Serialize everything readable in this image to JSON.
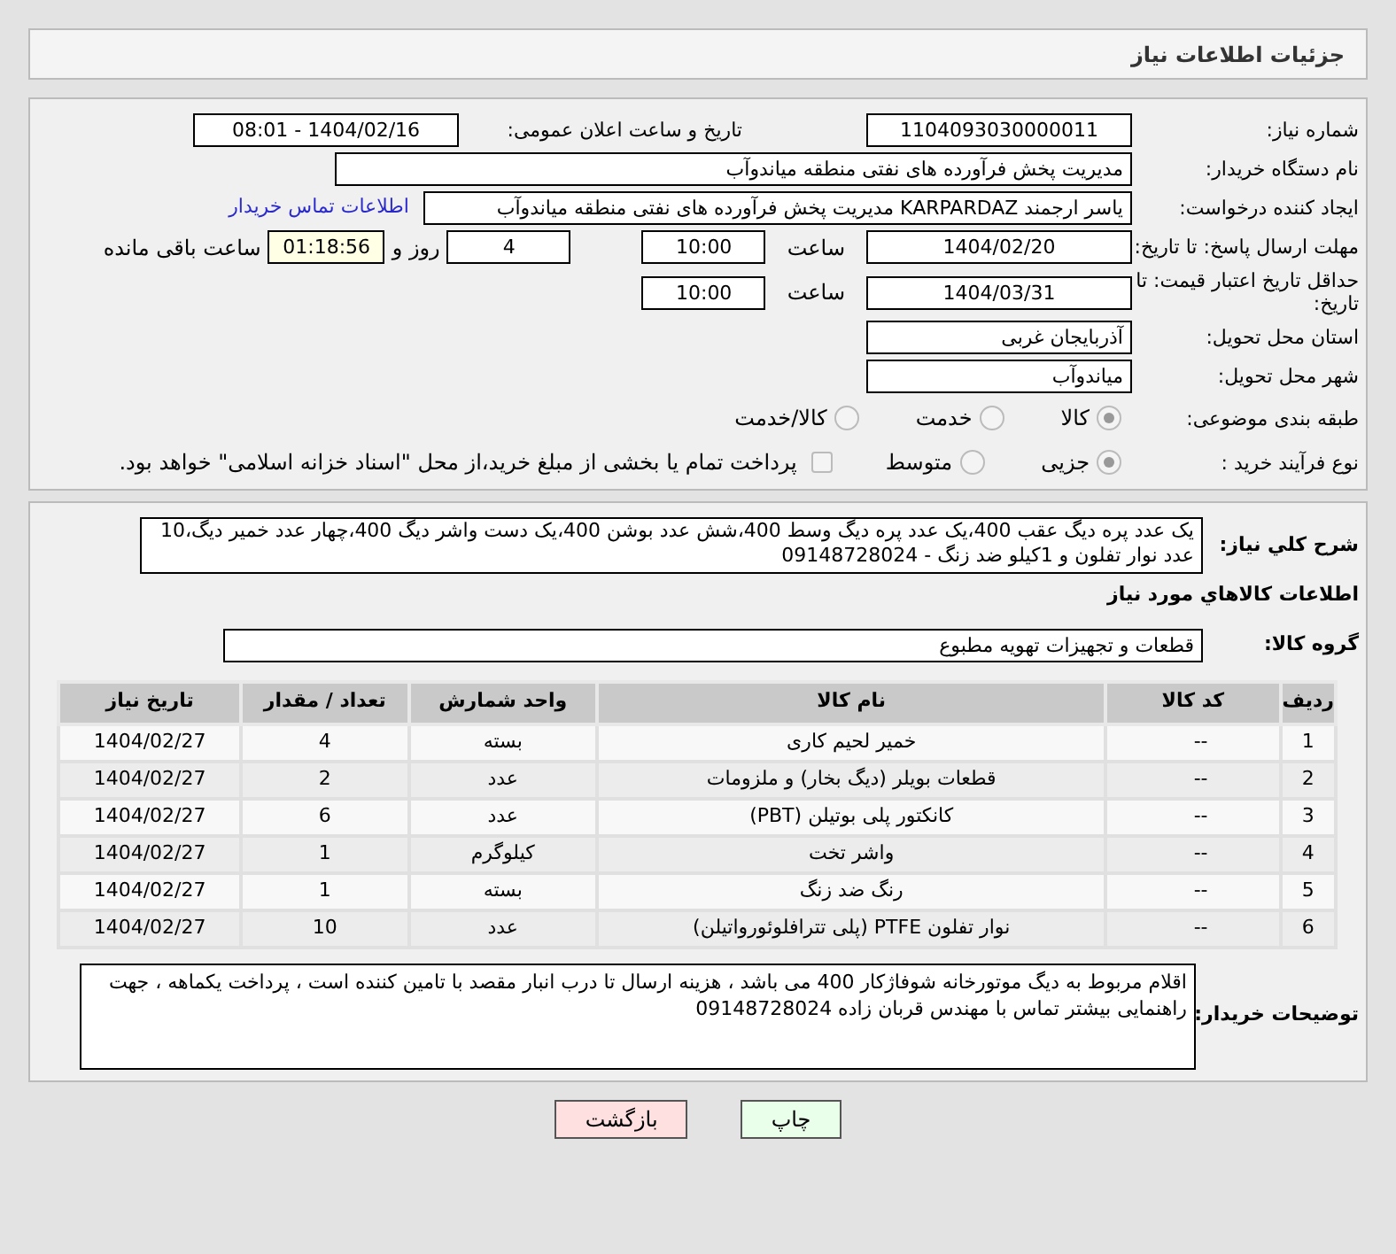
{
  "header": {
    "title": "جزئیات اطلاعات نیاز"
  },
  "form": {
    "need_number": {
      "label": "شماره نیاز:",
      "value": "1104093030000011"
    },
    "announce": {
      "label": "تاریخ و ساعت اعلان عمومی:",
      "value": "1404/02/16 - 08:01"
    },
    "buyer_org": {
      "label": "نام دستگاه خریدار:",
      "value": "مدیریت پخش فرآورده های نفتی منطقه میاندوآب"
    },
    "requester": {
      "label": "ایجاد کننده درخواست:",
      "value": "یاسر ارجمند KARPARDAZ مدیریت پخش فرآورده های نفتی منطقه میاندوآب",
      "link": "اطلاعات تماس خریدار"
    },
    "deadline": {
      "label": "مهلت ارسال پاسخ: تا تاریخ:",
      "date": "1404/02/20",
      "time_label": "ساعت",
      "time": "10:00",
      "days": "4",
      "days_label": "روز و",
      "remaining": "01:18:56",
      "remaining_label": "ساعت باقی مانده"
    },
    "validity": {
      "label": "حداقل تاریخ اعتبار قیمت: تا تاریخ:",
      "date": "1404/03/31",
      "time_label": "ساعت",
      "time": "10:00"
    },
    "province": {
      "label": "استان محل تحویل:",
      "value": "آذربایجان غربی"
    },
    "city": {
      "label": "شهر محل تحویل:",
      "value": "میاندوآب"
    },
    "category": {
      "label": "طبقه بندی موضوعی:",
      "options": [
        {
          "label": "کالا",
          "selected": true
        },
        {
          "label": "خدمت",
          "selected": false
        },
        {
          "label": "کالا/خدمت",
          "selected": false
        }
      ]
    },
    "process": {
      "label": "نوع فرآیند خرید :",
      "options": [
        {
          "label": "جزیی",
          "selected": true
        },
        {
          "label": "متوسط",
          "selected": false
        }
      ],
      "payment_checkbox": {
        "label": "پرداخت تمام یا بخشی از مبلغ خرید،از محل \"اسناد خزانه اسلامی\" خواهد بود.",
        "checked": false
      }
    }
  },
  "summary": {
    "label": "شرح کلي نياز:",
    "value": "یک عدد پره دیگ عقب 400،یک عدد پره دیگ وسط 400،شش عدد بوشن 400،یک دست واشر دیگ 400،چهار عدد خمیر دیگ،10 عدد نوار تفلون و 1کیلو ضد زنگ - 09148728024"
  },
  "goods_title": "اطلاعات کالاهاي مورد نياز",
  "goods_group": {
    "label": "گروه کالا:",
    "value": "قطعات و تجهیزات تهویه مطبوع"
  },
  "table": {
    "columns": [
      "ردیف",
      "کد کالا",
      "نام کالا",
      "واحد شمارش",
      "تعداد / مقدار",
      "تاریخ نیاز"
    ],
    "rows": [
      [
        "1",
        "--",
        "خمیر لحیم کاری",
        "بسته",
        "4",
        "1404/02/27"
      ],
      [
        "2",
        "--",
        "قطعات بویلر (دیگ بخار) و ملزومات",
        "عدد",
        "2",
        "1404/02/27"
      ],
      [
        "3",
        "--",
        "کانکتور پلی بوتیلن (PBT)",
        "عدد",
        "6",
        "1404/02/27"
      ],
      [
        "4",
        "--",
        "واشر تخت",
        "کیلوگرم",
        "1",
        "1404/02/27"
      ],
      [
        "5",
        "--",
        "رنگ ضد زنگ",
        "بسته",
        "1",
        "1404/02/27"
      ],
      [
        "6",
        "--",
        "نوار تفلون PTFE (پلی تترافلوئورواتیلن)",
        "عدد",
        "10",
        "1404/02/27"
      ]
    ]
  },
  "buyer_notes": {
    "label": "توضیحات خریدار:",
    "value": "اقلام مربوط به دیگ موتورخانه شوفاژکار 400 می باشد ، هزینه ارسال تا درب انبار مقصد با تامین کننده است ، پرداخت یکماهه ، جهت راهنمایی بیشتر تماس با مهندس قربان زاده   09148728024"
  },
  "buttons": [
    {
      "kind": "print",
      "label": "چاپ"
    },
    {
      "kind": "back",
      "label": "بازگشت"
    }
  ]
}
